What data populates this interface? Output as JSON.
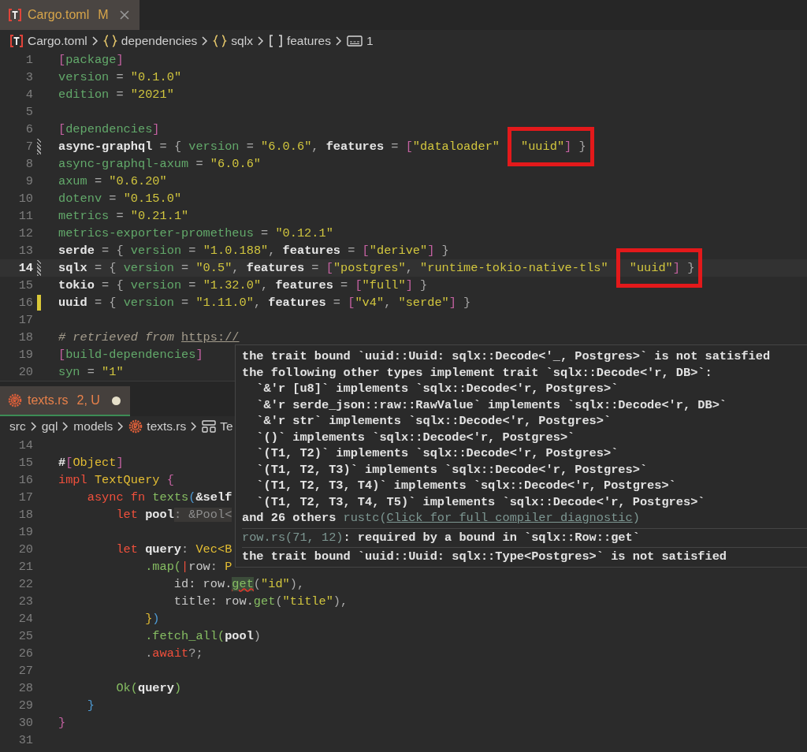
{
  "top_editor": {
    "tab": {
      "kind": "toml",
      "label": "Cargo.toml",
      "status": "M",
      "selected": true,
      "dirty": false
    },
    "breadcrumbs": [
      {
        "kind": "toml",
        "text": "Cargo.toml"
      },
      {
        "kind": "object",
        "text": "dependencies"
      },
      {
        "kind": "object",
        "text": "sqlx"
      },
      {
        "kind": "array",
        "text": "features"
      },
      {
        "kind": "string",
        "text": "1"
      }
    ],
    "lines": [
      {
        "number": "1",
        "tokens": [
          {
            "text": "[",
            "kind": "bracket"
          },
          {
            "text": "package",
            "kind": "section"
          },
          {
            "text": "]",
            "kind": "bracket"
          }
        ]
      },
      {
        "number": "3",
        "tokens": [
          {
            "text": "version",
            "kind": "key"
          },
          {
            "text": " = ",
            "kind": "punct"
          },
          {
            "text": "\"0.1.0\"",
            "kind": "string"
          }
        ]
      },
      {
        "number": "4",
        "tokens": [
          {
            "text": "edition",
            "kind": "key"
          },
          {
            "text": " = ",
            "kind": "punct"
          },
          {
            "text": "\"2021\"",
            "kind": "string"
          }
        ]
      },
      {
        "number": "5"
      },
      {
        "number": "6",
        "tokens": [
          {
            "text": "[",
            "kind": "bracket"
          },
          {
            "text": "dependencies",
            "kind": "section"
          },
          {
            "text": "]",
            "kind": "bracket"
          }
        ]
      },
      {
        "number": "7",
        "modified": true,
        "tokens": [
          {
            "text": "async-graphql",
            "kind": "key-strong"
          },
          {
            "text": " = { ",
            "kind": "punct"
          },
          {
            "text": "version",
            "kind": "key"
          },
          {
            "text": " = ",
            "kind": "punct"
          },
          {
            "text": "\"6.0.6\"",
            "kind": "string"
          },
          {
            "text": ", ",
            "kind": "punct"
          },
          {
            "text": "features",
            "kind": "key-strong"
          },
          {
            "text": " = ",
            "kind": "punct"
          },
          {
            "text": "[",
            "kind": "bracket"
          },
          {
            "text": "\"dataloader\"",
            "kind": "string"
          }
        ],
        "boxed": [
          {
            "text": "\"uuid\"",
            "kind": "string"
          },
          {
            "text": "]",
            "kind": "bracket"
          },
          {
            "text": " }",
            "kind": "punct"
          }
        ]
      },
      {
        "number": "8",
        "tokens": [
          {
            "text": "async-graphql-axum",
            "kind": "key"
          },
          {
            "text": " = ",
            "kind": "punct"
          },
          {
            "text": "\"6.0.6\"",
            "kind": "string"
          }
        ]
      },
      {
        "number": "9",
        "tokens": [
          {
            "text": "axum",
            "kind": "key"
          },
          {
            "text": " = ",
            "kind": "punct"
          },
          {
            "text": "\"0.6.20\"",
            "kind": "string"
          }
        ]
      },
      {
        "number": "10",
        "tokens": [
          {
            "text": "dotenv",
            "kind": "key"
          },
          {
            "text": " = ",
            "kind": "punct"
          },
          {
            "text": "\"0.15.0\"",
            "kind": "string"
          }
        ]
      },
      {
        "number": "11",
        "tokens": [
          {
            "text": "metrics",
            "kind": "key"
          },
          {
            "text": " = ",
            "kind": "punct"
          },
          {
            "text": "\"0.21.1\"",
            "kind": "string"
          }
        ]
      },
      {
        "number": "12",
        "tokens": [
          {
            "text": "metrics-exporter-prometheus",
            "kind": "key"
          },
          {
            "text": " = ",
            "kind": "punct"
          },
          {
            "text": "\"0.12.1\"",
            "kind": "string"
          }
        ]
      },
      {
        "number": "13",
        "tokens": [
          {
            "text": "serde",
            "kind": "key-strong"
          },
          {
            "text": " = { ",
            "kind": "punct"
          },
          {
            "text": "version",
            "kind": "key"
          },
          {
            "text": " = ",
            "kind": "punct"
          },
          {
            "text": "\"1.0.188\"",
            "kind": "string"
          },
          {
            "text": ", ",
            "kind": "punct"
          },
          {
            "text": "features",
            "kind": "key-strong"
          },
          {
            "text": " = ",
            "kind": "punct"
          },
          {
            "text": "[",
            "kind": "bracket"
          },
          {
            "text": "\"derive\"",
            "kind": "string"
          },
          {
            "text": "]",
            "kind": "bracket"
          },
          {
            "text": " }",
            "kind": "punct"
          }
        ]
      },
      {
        "number": "14",
        "current": true,
        "modified": true,
        "tokens": [
          {
            "text": "sqlx",
            "kind": "key-strong"
          },
          {
            "text": " = { ",
            "kind": "punct"
          },
          {
            "text": "version",
            "kind": "key"
          },
          {
            "text": " = ",
            "kind": "punct"
          },
          {
            "text": "\"0.5\"",
            "kind": "string"
          },
          {
            "text": ", ",
            "kind": "punct"
          },
          {
            "text": "features",
            "kind": "key-strong"
          },
          {
            "text": " = ",
            "kind": "punct"
          },
          {
            "text": "[",
            "kind": "bracket"
          },
          {
            "text": "\"postgres\"",
            "kind": "string"
          },
          {
            "text": ", ",
            "kind": "punct"
          },
          {
            "text": "\"runtime-tokio-native-tls\"",
            "kind": "string"
          }
        ],
        "boxed": [
          {
            "text": "\"uuid\"",
            "kind": "string"
          },
          {
            "text": "]",
            "kind": "bracket"
          },
          {
            "text": " }",
            "kind": "punct"
          }
        ]
      },
      {
        "number": "15",
        "tokens": [
          {
            "text": "tokio",
            "kind": "key-strong"
          },
          {
            "text": " = { ",
            "kind": "punct"
          },
          {
            "text": "version",
            "kind": "key"
          },
          {
            "text": " = ",
            "kind": "punct"
          },
          {
            "text": "\"1.32.0\"",
            "kind": "string"
          },
          {
            "text": ", ",
            "kind": "punct"
          },
          {
            "text": "features",
            "kind": "key-strong"
          },
          {
            "text": " = ",
            "kind": "punct"
          },
          {
            "text": "[",
            "kind": "bracket"
          },
          {
            "text": "\"full\"",
            "kind": "string"
          },
          {
            "text": "]",
            "kind": "bracket"
          },
          {
            "text": " }",
            "kind": "punct"
          }
        ]
      },
      {
        "number": "16",
        "added": true,
        "tokens": [
          {
            "text": "uuid",
            "kind": "key-strong"
          },
          {
            "text": " = { ",
            "kind": "punct"
          },
          {
            "text": "version",
            "kind": "key"
          },
          {
            "text": " = ",
            "kind": "punct"
          },
          {
            "text": "\"1.11.0\"",
            "kind": "string"
          },
          {
            "text": ", ",
            "kind": "punct"
          },
          {
            "text": "features",
            "kind": "key-strong"
          },
          {
            "text": " = ",
            "kind": "punct"
          },
          {
            "text": "[",
            "kind": "bracket"
          },
          {
            "text": "\"v4\"",
            "kind": "string"
          },
          {
            "text": ", ",
            "kind": "punct"
          },
          {
            "text": "\"serde\"",
            "kind": "string"
          },
          {
            "text": "]",
            "kind": "bracket"
          },
          {
            "text": " }",
            "kind": "punct"
          }
        ]
      },
      {
        "number": "17"
      },
      {
        "number": "18",
        "tokens": [
          {
            "text": "# retrieved from ",
            "kind": "comment"
          },
          {
            "text": "https://",
            "kind": "comment-link"
          }
        ]
      },
      {
        "number": "19",
        "tokens": [
          {
            "text": "[",
            "kind": "bracket"
          },
          {
            "text": "build-dependencies",
            "kind": "section"
          },
          {
            "text": "]",
            "kind": "bracket"
          }
        ]
      },
      {
        "number": "20",
        "tokens": [
          {
            "text": "syn",
            "kind": "key"
          },
          {
            "text": " = ",
            "kind": "punct"
          },
          {
            "text": "\"1\"",
            "kind": "string"
          }
        ]
      }
    ]
  },
  "bottom_editor": {
    "tab": {
      "kind": "rust",
      "label": "texts.rs",
      "status": "2, U",
      "selected": true,
      "dirty": true
    },
    "breadcrumbs": [
      {
        "text": "src"
      },
      {
        "text": "gql"
      },
      {
        "text": "models"
      },
      {
        "kind": "rust",
        "text": "texts.rs"
      },
      {
        "kind": "struct",
        "text": "Te"
      }
    ],
    "lines": [
      {
        "number": "14"
      },
      {
        "number": "15",
        "tokens": [
          {
            "text": "#",
            "kind": "var"
          },
          {
            "text": "[",
            "kind": "bracket"
          },
          {
            "text": "Object",
            "kind": "type"
          },
          {
            "text": "]",
            "kind": "bracket"
          }
        ]
      },
      {
        "number": "16",
        "tokens": [
          {
            "text": "impl ",
            "kind": "keyword"
          },
          {
            "text": "TextQuery ",
            "kind": "type"
          },
          {
            "text": "{",
            "kind": "bracket"
          }
        ]
      },
      {
        "number": "17",
        "tokens": [
          {
            "text": "    async fn ",
            "kind": "keyword"
          },
          {
            "text": "texts",
            "kind": "func"
          },
          {
            "text": "(",
            "kind": "brace"
          },
          {
            "text": "&self",
            "kind": "var"
          }
        ]
      },
      {
        "number": "18",
        "tokens": [
          {
            "text": "        let ",
            "kind": "keyword"
          },
          {
            "text": "pool",
            "kind": "var"
          },
          {
            "text": ": &Pool<",
            "kind": "hint"
          }
        ]
      },
      {
        "number": "19"
      },
      {
        "number": "20",
        "tokens": [
          {
            "text": "        let ",
            "kind": "keyword"
          },
          {
            "text": "query",
            "kind": "var"
          },
          {
            "text": ": ",
            "kind": "punct"
          },
          {
            "text": "Vec<B",
            "kind": "type"
          }
        ]
      },
      {
        "number": "21",
        "tokens": [
          {
            "text": "            .map(",
            "kind": "func"
          },
          {
            "text": "|",
            "kind": "keyword"
          },
          {
            "text": "row",
            "kind": "plain"
          },
          {
            "text": ": ",
            "kind": "punct"
          },
          {
            "text": "P",
            "kind": "type"
          }
        ]
      },
      {
        "number": "22",
        "tokens": [
          {
            "text": "                id: row.",
            "kind": "plain"
          },
          {
            "text": "get",
            "kind": "error"
          },
          {
            "text": "(",
            "kind": "punct"
          },
          {
            "text": "\"id\"",
            "kind": "string"
          },
          {
            "text": "),",
            "kind": "punct"
          }
        ]
      },
      {
        "number": "23",
        "tokens": [
          {
            "text": "                title: row.",
            "kind": "plain"
          },
          {
            "text": "get",
            "kind": "func"
          },
          {
            "text": "(",
            "kind": "punct"
          },
          {
            "text": "\"title\"",
            "kind": "string"
          },
          {
            "text": "),",
            "kind": "punct"
          }
        ]
      },
      {
        "number": "24",
        "tokens": [
          {
            "text": "            }",
            "kind": "type"
          },
          {
            "text": ")",
            "kind": "brace"
          }
        ]
      },
      {
        "number": "25",
        "tokens": [
          {
            "text": "            .fetch_all(",
            "kind": "func"
          },
          {
            "text": "pool",
            "kind": "var"
          },
          {
            "text": ")",
            "kind": "punct"
          }
        ]
      },
      {
        "number": "26",
        "tokens": [
          {
            "text": "            .",
            "kind": "punct"
          },
          {
            "text": "await",
            "kind": "keyword"
          },
          {
            "text": "?;",
            "kind": "punct"
          }
        ]
      },
      {
        "number": "27"
      },
      {
        "number": "28",
        "tokens": [
          {
            "text": "        Ok(",
            "kind": "func"
          },
          {
            "text": "query",
            "kind": "var"
          },
          {
            "text": ")",
            "kind": "func"
          }
        ]
      },
      {
        "number": "29",
        "tokens": [
          {
            "text": "    }",
            "kind": "brace"
          }
        ]
      },
      {
        "number": "30",
        "tokens": [
          {
            "text": "}",
            "kind": "bracket"
          }
        ]
      },
      {
        "number": "31"
      }
    ]
  },
  "hover_popup": {
    "sections": [
      [
        {
          "parts": [
            {
              "text": "the trait bound `uuid::Uuid: sqlx::Decode<'_, Postgres>` is not satisfied",
              "kind": "message"
            }
          ]
        },
        {
          "parts": [
            {
              "text": "the following other types implement trait `sqlx::Decode<'r, DB>`:",
              "kind": "message"
            }
          ]
        },
        {
          "parts": [
            {
              "text": "  `&'r [u8]` implements `sqlx::Decode<'r, Postgres>`",
              "kind": "message"
            }
          ]
        },
        {
          "parts": [
            {
              "text": "  `&'r serde_json::raw::RawValue` implements `sqlx::Decode<'r, DB>`",
              "kind": "message"
            }
          ]
        },
        {
          "parts": [
            {
              "text": "  `&'r str` implements `sqlx::Decode<'r, Postgres>`",
              "kind": "message"
            }
          ]
        },
        {
          "parts": [
            {
              "text": "  `()` implements `sqlx::Decode<'r, Postgres>`",
              "kind": "message"
            }
          ]
        },
        {
          "parts": [
            {
              "text": "  `(T1, T2)` implements `sqlx::Decode<'r, Postgres>`",
              "kind": "message"
            }
          ]
        },
        {
          "parts": [
            {
              "text": "  `(T1, T2, T3)` implements `sqlx::Decode<'r, Postgres>`",
              "kind": "message"
            }
          ]
        },
        {
          "parts": [
            {
              "text": "  `(T1, T2, T3, T4)` implements `sqlx::Decode<'r, Postgres>`",
              "kind": "message"
            }
          ]
        },
        {
          "parts": [
            {
              "text": "  `(T1, T2, T3, T4, T5)` implements `sqlx::Decode<'r, Postgres>`",
              "kind": "message"
            }
          ]
        },
        {
          "parts": [
            {
              "text": "and 26 others ",
              "kind": "message"
            },
            {
              "text": "rustc(",
              "kind": "source"
            },
            {
              "text": "Click for full compiler diagnostic",
              "kind": "link"
            },
            {
              "text": ")",
              "kind": "source"
            }
          ]
        }
      ],
      [
        {
          "parts": [
            {
              "text": "row.rs(71, 12)",
              "kind": "source"
            },
            {
              "text": ": required by a bound in `sqlx::Row::get`",
              "kind": "message"
            }
          ]
        }
      ],
      [
        {
          "parts": [
            {
              "text": "the trait bound `uuid::Uuid: sqlx::Type<Postgres>` is not satisfied",
              "kind": "message"
            }
          ]
        }
      ]
    ]
  }
}
